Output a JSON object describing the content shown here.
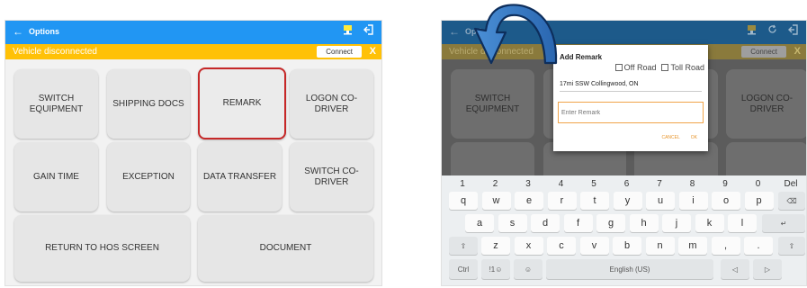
{
  "left": {
    "topbar": {
      "back_glyph": "←",
      "title": "Options"
    },
    "status": {
      "message": "Vehicle disconnected",
      "connect_label": "Connect",
      "close_label": "X"
    },
    "buttons": {
      "switch_equipment": "SWITCH\nEQUIPMENT",
      "shipping_docs": "SHIPPING DOCS",
      "remark": "REMARK",
      "logon_codriver": "LOGON CO-DRIVER",
      "gain_time": "GAIN TIME",
      "exception": "EXCEPTION",
      "data_transfer": "DATA TRANSFER",
      "switch_codriver": "SWITCH CO-\nDRIVER",
      "return_hos": "RETURN TO HOS SCREEN",
      "document": "DOCUMENT"
    }
  },
  "right": {
    "topbar": {
      "back_glyph": "←",
      "title": "Options"
    },
    "status": {
      "message": "Vehicle disconnected",
      "connect_label": "Connect",
      "close_label": "X"
    },
    "buttons": {
      "switch_equipment": "SWITCH\nEQUIPMENT",
      "logon_codriver": "LOGON CO-DRIVER",
      "gain_time": "GAIN TIME",
      "exception": "EXCEPTION",
      "data_transfer": "DATA TRANSFER",
      "switch_codriver": "SWITCH CO-"
    },
    "dialog": {
      "title": "Add Remark",
      "off_road": "Off Road",
      "toll_road": "Toll Road",
      "location": "17mi SSW Collingwood, ON",
      "remark_placeholder": "Enter Remark",
      "cancel_label": "CANCEL",
      "ok_label": "OK"
    },
    "keyboard": {
      "numbers": [
        "1",
        "2",
        "3",
        "4",
        "5",
        "6",
        "7",
        "8",
        "9",
        "0",
        "Del"
      ],
      "row1": [
        "q",
        "w",
        "e",
        "r",
        "t",
        "y",
        "u",
        "i",
        "o",
        "p"
      ],
      "row1_hints": [
        "",
        "",
        "",
        "",
        "",
        "",
        "",
        "",
        "",
        ""
      ],
      "row2": [
        "a",
        "s",
        "d",
        "f",
        "g",
        "h",
        "j",
        "k",
        "l"
      ],
      "row3": [
        "z",
        "x",
        "c",
        "v",
        "b",
        "n",
        "m",
        ",",
        "."
      ],
      "ctrl": "Ctrl",
      "lang_key": "!1☺",
      "emoji": "☺",
      "space": "English (US)",
      "left_arrow": "◁",
      "right_arrow": "▷",
      "backspace": "⌫",
      "enter": "↵",
      "shift": "⇧"
    }
  },
  "colors": {
    "accent_blue": "#2196f3",
    "status_yellow": "#ffc107",
    "highlight_red": "#c62828",
    "dialog_orange": "#f0a44a",
    "arrow_blue": "#2a66b0"
  }
}
